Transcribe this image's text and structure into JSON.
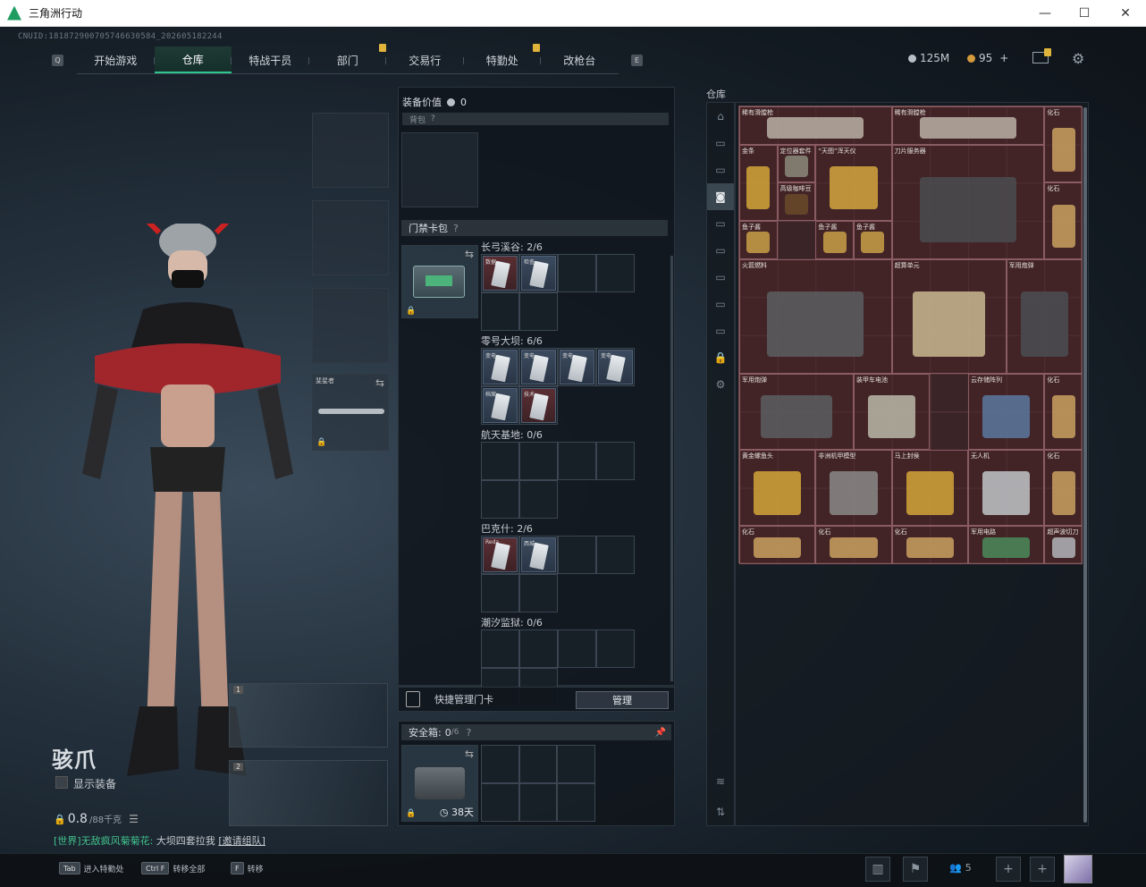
{
  "window": {
    "title": "三角洲行动"
  },
  "uid": "CNUID:181872900705746630584_202605182244",
  "nav": {
    "tabs": [
      "开始游戏",
      "仓库",
      "特战干员",
      "部门",
      "交易行",
      "特勤处",
      "改枪台"
    ],
    "active_index": 1,
    "badge_tabs": [
      3,
      5
    ]
  },
  "currency": {
    "money": "125M",
    "coins": "95",
    "plus": "+"
  },
  "colors": {
    "accent": "#31c48d",
    "badge": "#e0b43a",
    "warehouse_bg": "#3b2427"
  },
  "operator": {
    "name": "骇爪",
    "show_equipment": "显示装备",
    "weight_value": "0.8",
    "weight_max": "/88千克"
  },
  "weapon_slots": [
    "1",
    "2"
  ],
  "chat": {
    "prefix": "[世界]",
    "sender": "无敌疯风菊菊花:",
    "message": "大坝四套拉我",
    "link": "[邀请组队]"
  },
  "equipment": {
    "value_label": "装备价值",
    "value": "0",
    "backpack_label": "背包",
    "help": "?",
    "melee_label": "斐星者"
  },
  "keycard": {
    "section_label": "门禁卡包",
    "maps": [
      {
        "name": "长弓溪谷: 2/6",
        "cards": [
          {
            "label": "数据",
            "color": "red"
          },
          {
            "label": "检查",
            "color": "blue"
          }
        ]
      },
      {
        "name": "零号大坝: 6/6",
        "cards": [
          {
            "label": "变电",
            "color": "blue"
          },
          {
            "label": "变电",
            "color": "blue"
          },
          {
            "label": "变电",
            "color": "blue"
          },
          {
            "label": "变电",
            "color": "blue"
          },
          {
            "label": "档案",
            "color": "blue"
          },
          {
            "label": "技术",
            "color": "red"
          }
        ]
      },
      {
        "name": "航天基地: 0/6",
        "cards": []
      },
      {
        "name": "巴克什: 2/6",
        "cards": [
          {
            "label": "Reda",
            "color": "red"
          },
          {
            "label": "西城",
            "color": "blue"
          }
        ]
      },
      {
        "name": "潮汐监狱: 0/6",
        "cards": []
      }
    ]
  },
  "quick_manage": {
    "label": "快捷管理门卡",
    "button": "管理"
  },
  "safebox": {
    "label": "安全箱:",
    "count": "0",
    "capacity": "/6",
    "days": "38天"
  },
  "warehouse": {
    "title": "仓库",
    "items": [
      {
        "label": "稀有滑膛枪"
      },
      {
        "label": "稀有滑膛枪"
      },
      {
        "label": "化石"
      },
      {
        "label": "金条"
      },
      {
        "label": "定位器套件"
      },
      {
        "label": "“天图”浑天仪"
      },
      {
        "label": "刀片服务器"
      },
      {
        "label": "高级咖啡豆"
      },
      {
        "label": "化石"
      },
      {
        "label": "鱼子酱"
      },
      {
        "label": "鱼子酱"
      },
      {
        "label": "鱼子酱"
      },
      {
        "label": "火箭燃料"
      },
      {
        "label": "超算单元"
      },
      {
        "label": "军用炮弹"
      },
      {
        "label": "军用炮弹"
      },
      {
        "label": "装甲车电池"
      },
      {
        "label": "云存储阵列"
      },
      {
        "label": "化石"
      },
      {
        "label": "黄金螺鱼头"
      },
      {
        "label": "非洲机甲模型"
      },
      {
        "label": "马上封侯"
      },
      {
        "label": "无人机"
      },
      {
        "label": "化石"
      },
      {
        "label": "化石"
      },
      {
        "label": "化石"
      },
      {
        "label": "化石"
      },
      {
        "label": "军用电路"
      },
      {
        "label": "超声波切刀"
      }
    ]
  },
  "bottom": {
    "hints": [
      {
        "key": "Tab",
        "label": "进入特勤处"
      },
      {
        "key": "Ctrl F",
        "label": "转移全部"
      },
      {
        "key": "F",
        "label": "转移"
      }
    ],
    "party_count": "5"
  }
}
